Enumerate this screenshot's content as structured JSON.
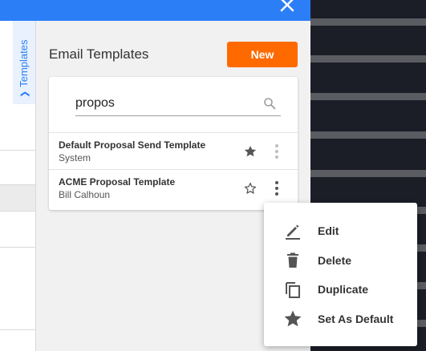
{
  "header": {
    "close_icon": "close-icon"
  },
  "side_tab": {
    "label": "Templates",
    "icon": "chevron-down-icon"
  },
  "panel": {
    "title": "Email Templates",
    "new_button_label": "New",
    "accent_color": "#ff6a00"
  },
  "search": {
    "value": "propos",
    "placeholder": "",
    "icon": "search-icon"
  },
  "templates": [
    {
      "name": "Default Proposal Send Template",
      "owner": "System",
      "is_default": true
    },
    {
      "name": "ACME Proposal Template",
      "owner": "Bill Calhoun",
      "is_default": false
    }
  ],
  "context_menu": {
    "items": [
      {
        "label": "Edit",
        "icon": "pencil-icon"
      },
      {
        "label": "Delete",
        "icon": "trash-icon"
      },
      {
        "label": "Duplicate",
        "icon": "copy-icon"
      },
      {
        "label": "Set As Default",
        "icon": "star-icon"
      }
    ]
  },
  "colors": {
    "topbar": "#2c7ef7",
    "dark_background": "#1b1e27"
  }
}
